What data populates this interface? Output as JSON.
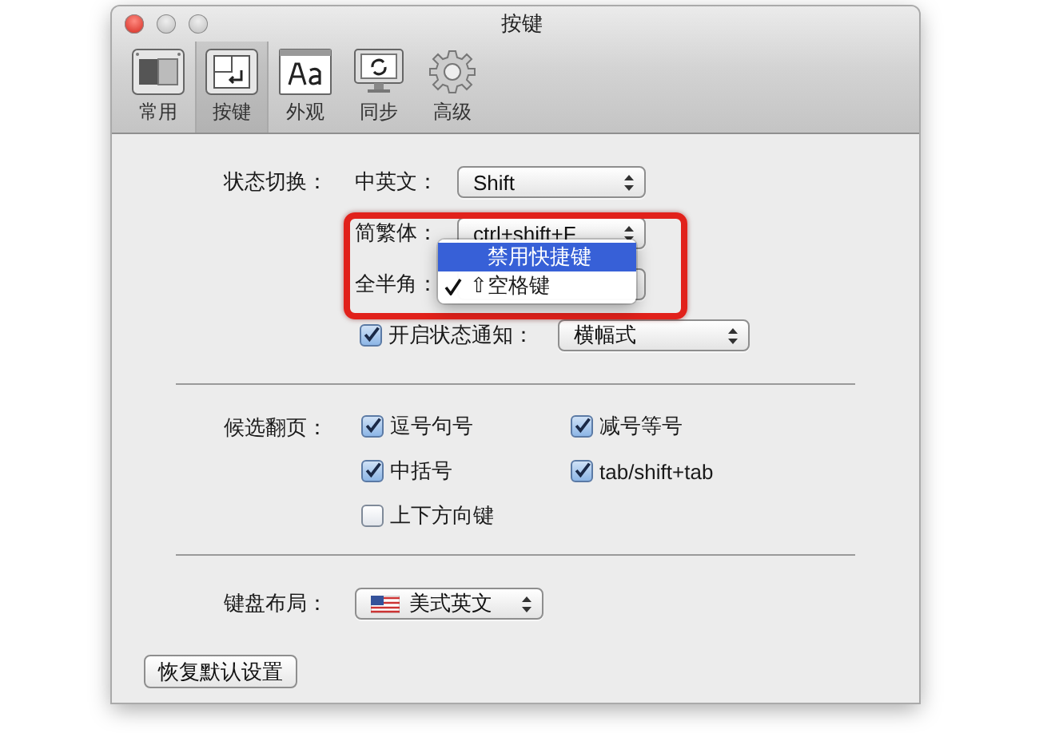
{
  "window": {
    "title": "按键"
  },
  "toolbar": {
    "items": [
      {
        "label": "常用",
        "kind": "general",
        "selected": false
      },
      {
        "label": "按键",
        "kind": "keys",
        "selected": true
      },
      {
        "label": "外观",
        "kind": "appearance",
        "selected": false
      },
      {
        "label": "同步",
        "kind": "sync",
        "selected": false
      },
      {
        "label": "高级",
        "kind": "advanced",
        "selected": false
      }
    ]
  },
  "state_switch": {
    "label": "状态切换：",
    "rows": [
      {
        "label": "中英文：",
        "value": "Shift"
      },
      {
        "label": "简繁体：",
        "value": "ctrl+shift+F"
      },
      {
        "label": "全半角："
      }
    ],
    "notification": {
      "label": "开启状态通知：",
      "checked": true,
      "value": "横幅式"
    }
  },
  "popup_menu": {
    "items": [
      {
        "label": "禁用快捷键",
        "selected": true,
        "checked": false
      },
      {
        "label": "⇧空格键",
        "selected": false,
        "checked": true
      }
    ]
  },
  "candidate_paging": {
    "label": "候选翻页：",
    "options": [
      {
        "label": "逗号句号",
        "checked": true
      },
      {
        "label": "减号等号",
        "checked": true
      },
      {
        "label": "中括号",
        "checked": true
      },
      {
        "label": "tab/shift+tab",
        "checked": true
      },
      {
        "label": "上下方向键",
        "checked": false
      }
    ]
  },
  "keyboard_layout": {
    "label": "键盘布局：",
    "value": "美式英文"
  },
  "reset_button": "恢复默认设置"
}
